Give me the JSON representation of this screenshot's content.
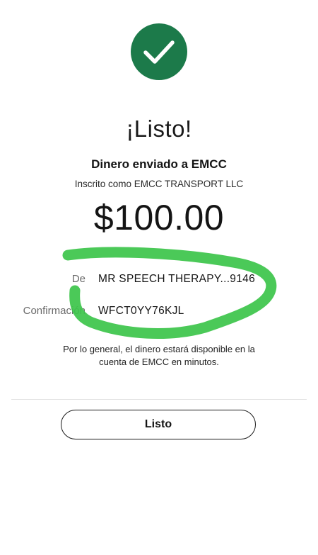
{
  "success": {
    "icon": "checkmark-icon",
    "icon_color": "#1c7a4a",
    "title": "¡Listo!"
  },
  "recipient": {
    "headline": "Dinero enviado a EMCC",
    "enrolled_as": "Inscrito como EMCC TRANSPORT LLC"
  },
  "amount": "$100.00",
  "details": {
    "from_label": "De",
    "from_value": "MR SPEECH THERAPY...9146",
    "confirmation_label": "Confirmación",
    "confirmation_value": "WFCT0YY76KJL"
  },
  "note": "Por lo general, el dinero estará disponible en la cuenta de EMCC en minutos.",
  "done_button": "Listo",
  "annotation": {
    "color": "#3cc44a"
  }
}
